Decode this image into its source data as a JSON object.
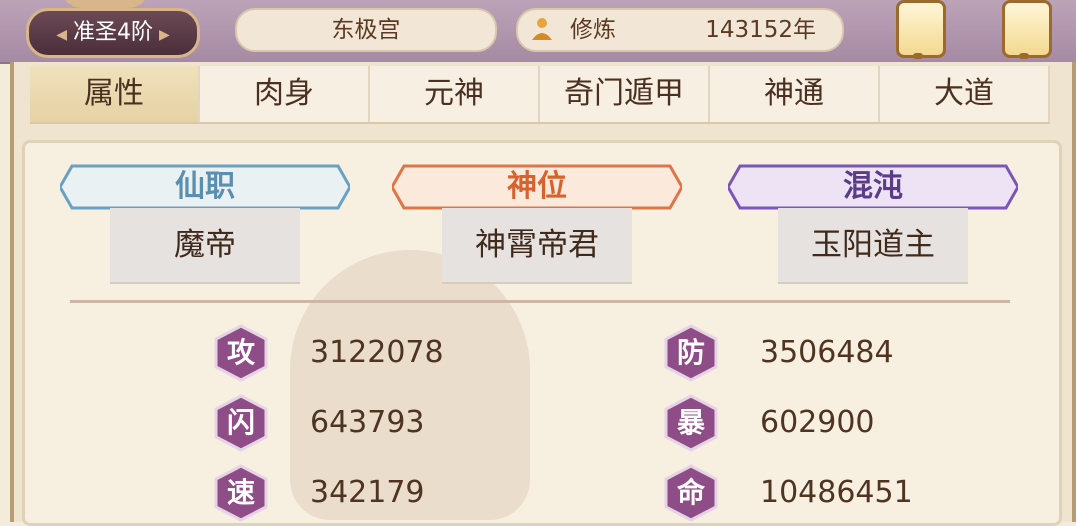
{
  "header": {
    "rank": "准圣4阶",
    "palace": "东极宫",
    "cultivation_label": "修炼",
    "cultivation_value": "143152年"
  },
  "tabs": [
    {
      "label": "属性",
      "active": true
    },
    {
      "label": "肉身",
      "active": false
    },
    {
      "label": "元神",
      "active": false
    },
    {
      "label": "奇门遁甲",
      "active": false
    },
    {
      "label": "神通",
      "active": false
    },
    {
      "label": "大道",
      "active": false
    }
  ],
  "titles": [
    {
      "label": "仙职",
      "value": "魔帝",
      "color": "#5a8fb0",
      "ribbon": "#e9f1f2",
      "edge": "#6aa0c2"
    },
    {
      "label": "神位",
      "value": "神霄帝君",
      "color": "#d8622e",
      "ribbon": "#fbe9dc",
      "edge": "#e07446"
    },
    {
      "label": "混沌",
      "value": "玉阳道主",
      "color": "#5b3c8a",
      "ribbon": "#eee3f4",
      "edge": "#7a56b8"
    }
  ],
  "stats": [
    {
      "label": "攻",
      "value": "3122078"
    },
    {
      "label": "防",
      "value": "3506484"
    },
    {
      "label": "闪",
      "value": "643793"
    },
    {
      "label": "暴",
      "value": "602900"
    },
    {
      "label": "速",
      "value": "342179"
    },
    {
      "label": "命",
      "value": "10486451"
    }
  ],
  "colors": {
    "stat_hex": "#8e4d86",
    "stat_hex_border": "#e6d4e6"
  }
}
